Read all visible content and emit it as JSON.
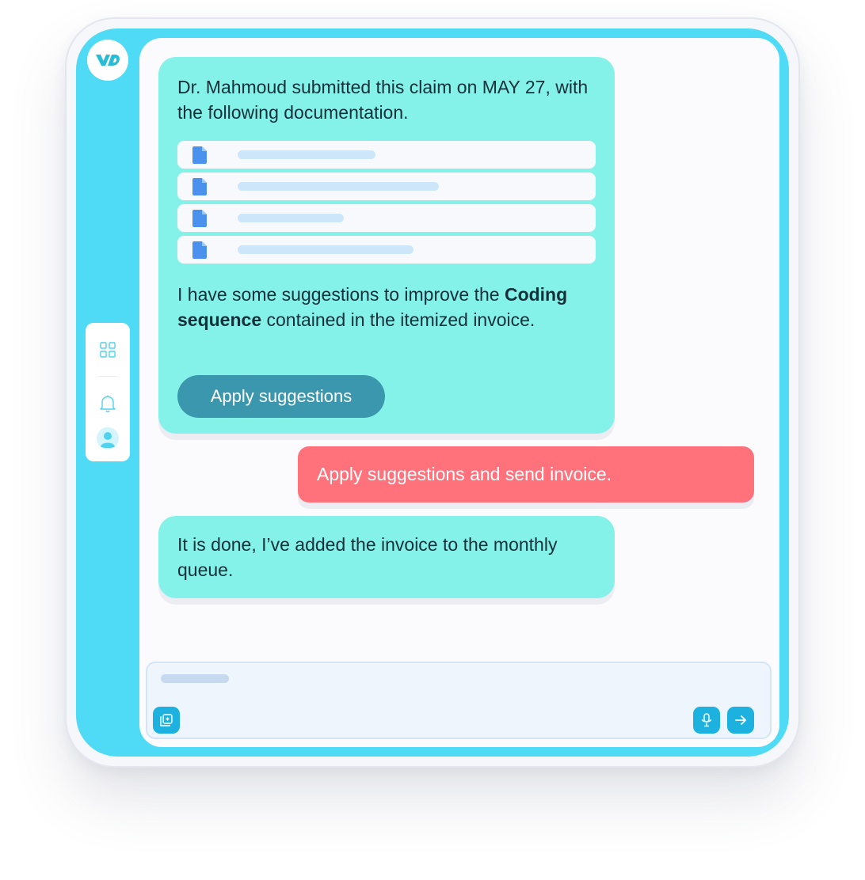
{
  "app": {
    "logo_icon": "vd-logo-icon",
    "accent_color": "#4fdaf5",
    "user_bubble_color": "#ff727c",
    "ai_bubble_color": "#84f2e9"
  },
  "sidebar": {
    "icons": [
      "grid-icon",
      "bell-icon",
      "user-avatar-icon"
    ]
  },
  "messages": {
    "first": {
      "line1": "Dr. Mahmoud submitted this claim on MAY 27, with the following documentation.",
      "docs": [
        "file-icon",
        "file-icon",
        "file-icon",
        "file-icon"
      ],
      "para2_before": "I have some suggestions to improve the ",
      "para2_bold": "Coding sequence",
      "para2_after": " contained in the itemized invoice.",
      "button_label": "Apply suggestions"
    },
    "user": {
      "text": "Apply suggestions and send invoice."
    },
    "reply": {
      "text": "It is done, I’ve added the invoice to the monthly queue."
    }
  },
  "composer": {
    "attach_icon": "attach-copy-icon",
    "mic_icon": "microphone-icon",
    "send_icon": "arrow-right-icon"
  }
}
